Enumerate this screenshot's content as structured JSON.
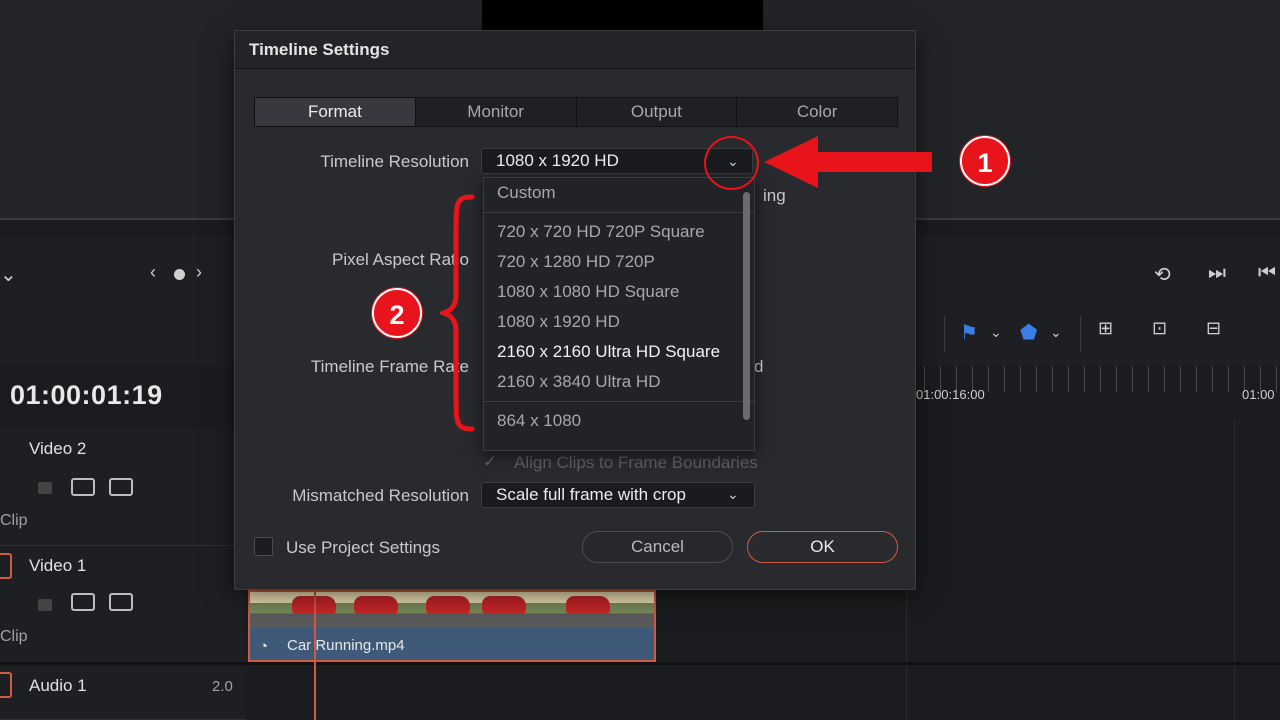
{
  "dialog": {
    "title": "Timeline Settings",
    "tabs": [
      {
        "label": "Format",
        "active": true
      },
      {
        "label": "Monitor",
        "active": false
      },
      {
        "label": "Output",
        "active": false
      },
      {
        "label": "Color",
        "active": false
      }
    ],
    "timeline_resolution_label": "Timeline Resolution",
    "timeline_resolution_value": "1080 x 1920 HD",
    "partial_behind_text": "ing",
    "pixel_aspect_ratio_label": "Pixel Aspect Ratio",
    "timeline_frame_rate_label": "Timeline Frame Rate",
    "frame_rate_partial": "d",
    "align_clips_label": "Align Clips to Frame Boundaries",
    "mismatched_resolution_label": "Mismatched Resolution",
    "mismatched_resolution_value": "Scale full frame with crop",
    "use_project_settings_label": "Use Project Settings",
    "cancel_label": "Cancel",
    "ok_label": "OK"
  },
  "resolution_dropdown": {
    "items": [
      {
        "label": "Custom",
        "group": 0
      },
      {
        "label": "720 x 720 HD 720P Square",
        "group": 1
      },
      {
        "label": "720 x 1280 HD 720P",
        "group": 1
      },
      {
        "label": "1080 x 1080 HD Square",
        "group": 1
      },
      {
        "label": "1080 x 1920 HD",
        "group": 1
      },
      {
        "label": "2160 x 2160 Ultra HD Square",
        "group": 1,
        "hover": true
      },
      {
        "label": "2160 x 3840 Ultra HD",
        "group": 1
      },
      {
        "label": "864 x 1080",
        "group": 2
      }
    ]
  },
  "annotations": {
    "badge_1": "1",
    "badge_2": "2"
  },
  "editor": {
    "timecode": "01:00:01:19",
    "tracks": [
      {
        "name": "Video 2",
        "clip_label": "Clip"
      },
      {
        "name": "Video 1",
        "clip_label": "Clip"
      },
      {
        "name": "Audio 1",
        "level": "2.0"
      }
    ],
    "ruler_times": [
      "01:00:16:00",
      "01:00"
    ],
    "clip_name": "Car Running.mp4"
  },
  "colors": {
    "accent_red": "#e8131b",
    "clip_border": "#d05a43",
    "marker_blue": "#3a7ee8"
  }
}
